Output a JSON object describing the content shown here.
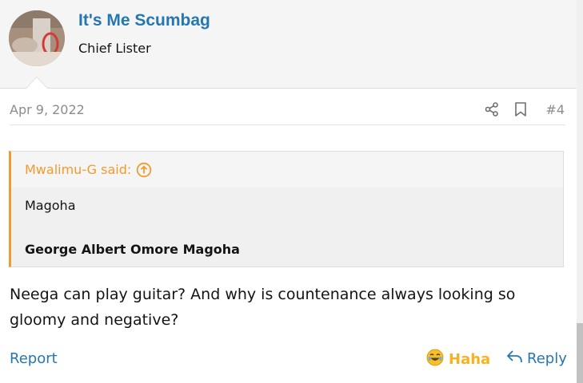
{
  "user": {
    "name": "It's Me Scumbag",
    "title": "Chief Lister"
  },
  "post": {
    "date": "Apr 9, 2022",
    "number": "#4",
    "text": "Neega can play guitar? And why is countenance always looking so gloomy and negative?"
  },
  "quote": {
    "author_line": "Mwalimu-G said:",
    "line1": "Magoha",
    "line2": "George Albert Omore Magoha"
  },
  "footer": {
    "report_label": "Report",
    "reaction_label": "Haha",
    "reply_label": "Reply"
  },
  "colors": {
    "link": "#2577b1",
    "quote_accent": "#f29a2e",
    "reaction": "#f5b223"
  },
  "icons": [
    "share-icon",
    "bookmark-icon",
    "arrow-up-circle-icon",
    "laughing-emoji-icon",
    "reply-icon"
  ]
}
